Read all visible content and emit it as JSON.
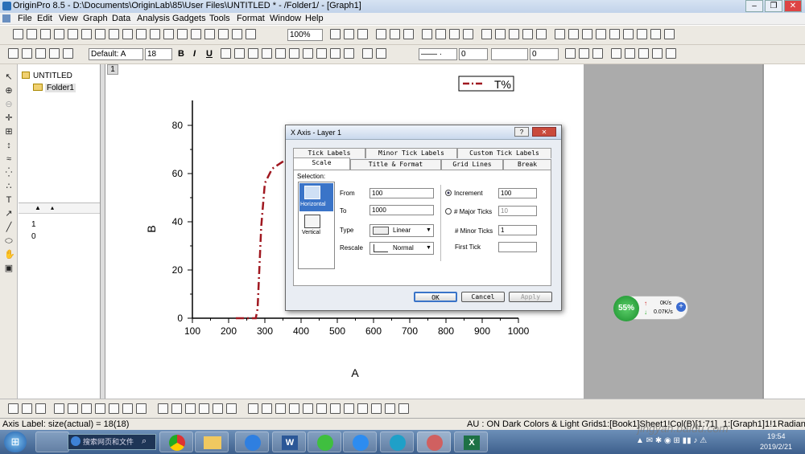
{
  "title": "OriginPro 8.5 - D:\\Documents\\OriginLab\\85\\User Files\\UNTITLED * - /Folder1/ - [Graph1]",
  "menu": [
    "File",
    "Edit",
    "View",
    "Graph",
    "Data",
    "Analysis",
    "Gadgets",
    "Tools",
    "Format",
    "Window",
    "Help"
  ],
  "toolbar": {
    "zoom": "100%",
    "font": "Default: A",
    "size": "18",
    "bold": "B",
    "italic": "I",
    "underline": "U",
    "line_width": "0",
    "fill": "0"
  },
  "project": {
    "root": "UNTITLED",
    "folder": "Folder1",
    "list": [
      "1",
      "0"
    ]
  },
  "graph": {
    "window_number": "1",
    "chart_data": {
      "type": "line",
      "xlabel": "A",
      "ylabel": "B",
      "xlim": [
        100,
        1000
      ],
      "ylim": [
        0,
        80
      ],
      "xticks": [
        "100",
        "200",
        "300",
        "400",
        "500",
        "600",
        "700",
        "800",
        "900",
        "1000"
      ],
      "yticks": [
        "0",
        "20",
        "40",
        "60",
        "80"
      ],
      "series": [
        {
          "name": "T%",
          "color": "#a01820",
          "style": "dash-dot",
          "x": [
            220,
            250,
            275,
            280,
            290,
            300,
            320,
            360
          ],
          "y": [
            0,
            0,
            0,
            4,
            38,
            56,
            62,
            66
          ]
        }
      ],
      "legend": "top-right"
    }
  },
  "dialog": {
    "title": "X Axis - Layer 1",
    "help": "?",
    "tabs_row1": [
      "Tick Labels",
      "Minor Tick Labels",
      "Custom Tick Labels"
    ],
    "tabs_row2": [
      "Scale",
      "Title & Format",
      "Grid Lines",
      "Break"
    ],
    "selection_label": "Selection:",
    "selection": [
      "Horizontal",
      "Vertical"
    ],
    "from_label": "From",
    "from_value": "100",
    "to_label": "To",
    "to_value": "1000",
    "type_label": "Type",
    "type_value": "Linear",
    "rescale_label": "Rescale",
    "rescale_value": "Normal",
    "increment_label": "Increment",
    "increment_value": "100",
    "major_label": "# Major Ticks",
    "major_value": "10",
    "minor_label": "# Minor Ticks",
    "minor_value": "1",
    "first_tick_label": "First Tick",
    "first_tick_value": "",
    "ok": "OK",
    "cancel": "Cancel",
    "apply": "Apply"
  },
  "network": {
    "percent": "55%",
    "up": "0K/s",
    "down": "0.07K/s"
  },
  "status": {
    "left": "Axis Label: size(actual) = 18(18)",
    "au": "AU : ON",
    "theme": "Dark Colors & Light Grids",
    "layer": "1:[Book1]Sheet1!Col(B)[1:71]",
    "graph": "1:[Graph1]1!1",
    "unit": "Radian"
  },
  "taskbar": {
    "search": "搜索网页和文件",
    "time": "19:54",
    "date": "2019/2/21"
  },
  "watermark": "jingyan.baidu.com"
}
